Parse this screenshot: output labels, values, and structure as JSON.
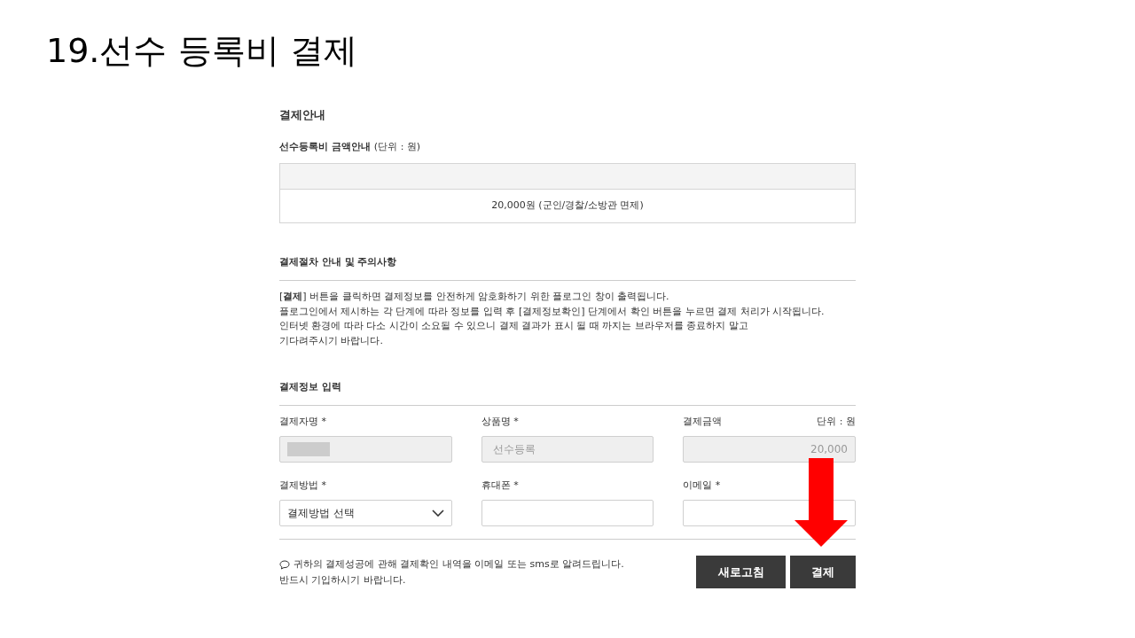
{
  "slide_title": "19.선수 등록비 결제",
  "guide": {
    "title": "결제안내",
    "subtitle": "선수등록비 금액안내",
    "unit": "(단위 : 원)",
    "fee": "20,000원 (군인/경찰/소방관 면제)"
  },
  "procedure": {
    "title": "결제절차 안내 및 주의사항",
    "lines": [
      "[**결제**] 버튼을 클릭하면 결제정보를 안전하게 암호화하기 위한 플로그인 창이 출력됩니다.",
      "플로그인에서 제시하는 각 단계에 따라 정보를 입력 후 [결제정보확인] 단계에서 확인 버튼을 누르면 결제 처리가 시작됩니다.",
      "인터넷 환경에 따라 다소 시간이 소요될 수 있으니 결제 결과가 표시 될 때 까지는 브라우저를 종료하지 말고",
      "기다려주시기 바랍니다."
    ]
  },
  "form": {
    "title": "결제정보 입력",
    "unit": "단위 : 원",
    "fields": [
      {
        "label": "결제자명 *",
        "kind": "redacted",
        "disabled": true
      },
      {
        "label": "상품명 *",
        "kind": "text",
        "value": "선수등록",
        "disabled": true
      },
      {
        "label": "결제금액",
        "kind": "amount",
        "value": "20,000",
        "disabled": true
      },
      {
        "label": "결제방법 *",
        "kind": "select",
        "value": "결제방법 선택",
        "disabled": false
      },
      {
        "label": "휴대폰 *",
        "kind": "text",
        "disabled": false
      },
      {
        "label": "이메일 *",
        "kind": "text",
        "disabled": false
      }
    ]
  },
  "notice": [
    "귀하의 결제성공에 관해 결제확인 내역을 이메일 또는 sms로 알려드립니다.",
    "반드시 기입하시기 바랍니다."
  ],
  "buttons": [
    {
      "label": "새로고침"
    },
    {
      "label": "결제"
    }
  ]
}
